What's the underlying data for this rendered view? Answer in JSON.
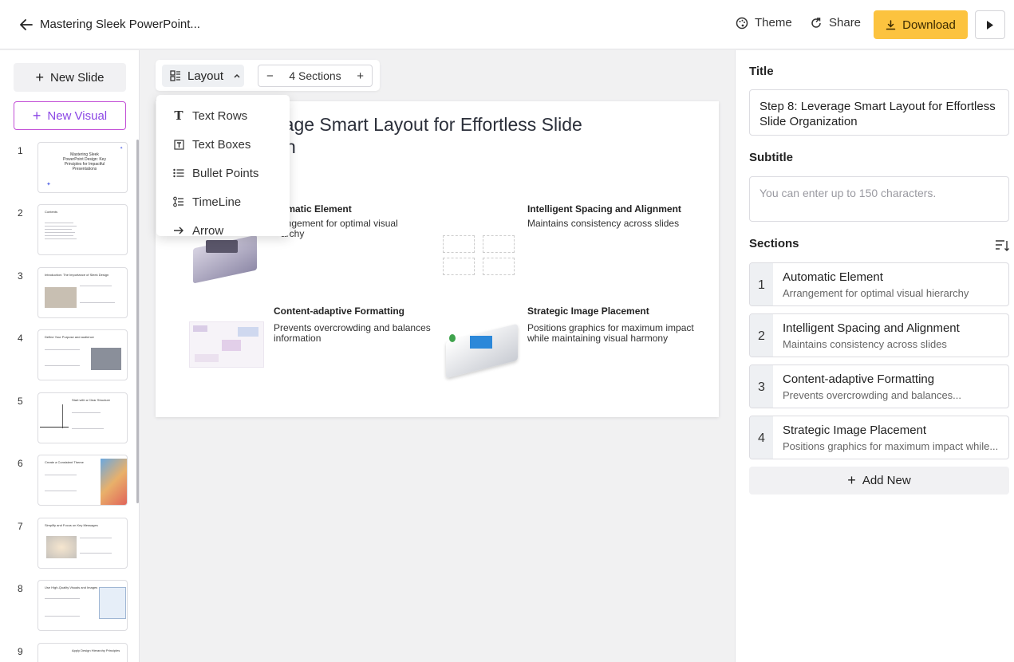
{
  "header": {
    "doc_title": "Mastering Sleek PowerPoint...",
    "theme_label": "Theme",
    "share_label": "Share",
    "download_label": "Download",
    "accent_color": "#fcc33f"
  },
  "sidebar": {
    "new_slide_label": "New Slide",
    "new_visual_label": "New Visual",
    "slides": [
      {
        "num": "1",
        "title": "Mastering Sleek PowerPoint Design: Key Principles for Impactful Presentations"
      },
      {
        "num": "2",
        "title": "Contents"
      },
      {
        "num": "3",
        "title": "Introduction: The Importance of Sleek Design"
      },
      {
        "num": "4",
        "title": "Define Your Purpose and audience"
      },
      {
        "num": "5",
        "title": "Start with a Clear Structure"
      },
      {
        "num": "6",
        "title": "Create a Consistent Theme"
      },
      {
        "num": "7",
        "title": "Simplify and Focus on Key Messages"
      },
      {
        "num": "8",
        "title": "Use High-Quality Visuals and Images"
      },
      {
        "num": "9",
        "title": "Apply Design Hierarchy Principles"
      }
    ]
  },
  "toolbar": {
    "layout_label": "Layout",
    "sections_label": "4 Sections",
    "minus": "−",
    "plus": "+"
  },
  "layout_menu": [
    {
      "label": "Text Rows",
      "icon": "text-rows-icon"
    },
    {
      "label": "Text Boxes",
      "icon": "text-boxes-icon"
    },
    {
      "label": "Bullet Points",
      "icon": "bullet-points-icon"
    },
    {
      "label": "TimeLine",
      "icon": "timeline-icon"
    },
    {
      "label": "Arrow",
      "icon": "arrow-icon"
    }
  ],
  "slide": {
    "title_line1": "rage Smart Layout for Effortless Slide",
    "title_line2": "n",
    "sections": [
      {
        "head": "omatic Element",
        "body": "angement for optimal visual",
        "body2": "archy"
      },
      {
        "head": "Intelligent Spacing and Alignment",
        "body": "Maintains consistency across slides"
      },
      {
        "head": "Content-adaptive Formatting",
        "body": "Prevents overcrowding and balances",
        "body2": "information"
      },
      {
        "head": "Strategic Image Placement",
        "body": "Positions graphics for maximum impact",
        "body2": "while maintaining visual harmony"
      }
    ]
  },
  "panel": {
    "title_label": "Title",
    "title_value": "Step 8: Leverage Smart Layout for Effortless Slide Organization",
    "subtitle_label": "Subtitle",
    "subtitle_placeholder": "You can enter up to 150 characters.",
    "sections_label": "Sections",
    "sections": [
      {
        "num": "1",
        "head": "Automatic Element",
        "sub": "Arrangement for optimal visual hierarchy"
      },
      {
        "num": "2",
        "head": "Intelligent Spacing and Alignment",
        "sub": "Maintains consistency across slides"
      },
      {
        "num": "3",
        "head": "Content-adaptive Formatting",
        "sub": "Prevents overcrowding and balances..."
      },
      {
        "num": "4",
        "head": "Strategic Image Placement",
        "sub": "Positions graphics for maximum impact while..."
      }
    ],
    "add_new_label": "Add New"
  }
}
